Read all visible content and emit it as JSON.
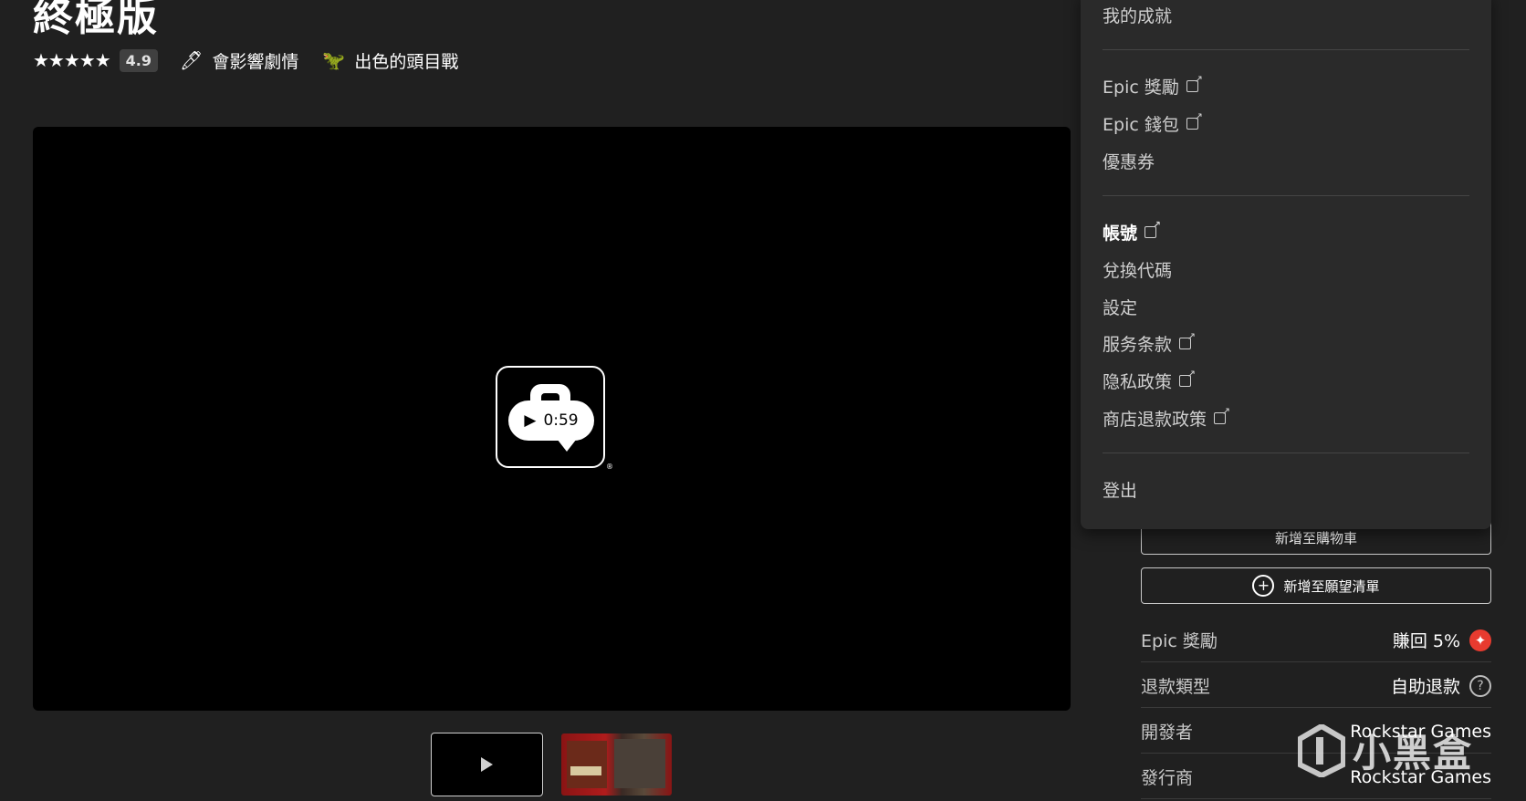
{
  "product": {
    "title": "終極版",
    "stars": "★★★★★",
    "rating": "4.9",
    "tags": [
      {
        "icon": "🖊",
        "label": "會影響劇情"
      },
      {
        "icon": "🦖",
        "label": "出色的頭目戰"
      }
    ]
  },
  "video": {
    "duration": "0:59",
    "registered_mark": "®"
  },
  "menu": {
    "achievements": "我的成就",
    "epic_rewards": "Epic 獎勵",
    "epic_wallet": "Epic 錢包",
    "coupons": "優惠券",
    "account": "帳號",
    "redeem_code": "兌換代碼",
    "settings": "設定",
    "terms": "服务条款",
    "privacy": "隐私政策",
    "refund_policy": "商店退款政策",
    "logout": "登出"
  },
  "sidebar": {
    "add_to_cart": "新增至購物車",
    "add_to_wishlist": "新增至願望清單",
    "rows": [
      {
        "label": "Epic 獎勵",
        "value": "賺回 5%"
      },
      {
        "label": "退款類型",
        "value": "自助退款"
      },
      {
        "label": "開發者",
        "value": "Rockstar Games"
      },
      {
        "label": "發行商",
        "value": "Rockstar Games"
      }
    ]
  },
  "watermark": {
    "text": "小黑盒"
  },
  "colors": {
    "background": "#202020",
    "menu_background": "#2a2a2a",
    "reward_red": "#e83b2f"
  }
}
